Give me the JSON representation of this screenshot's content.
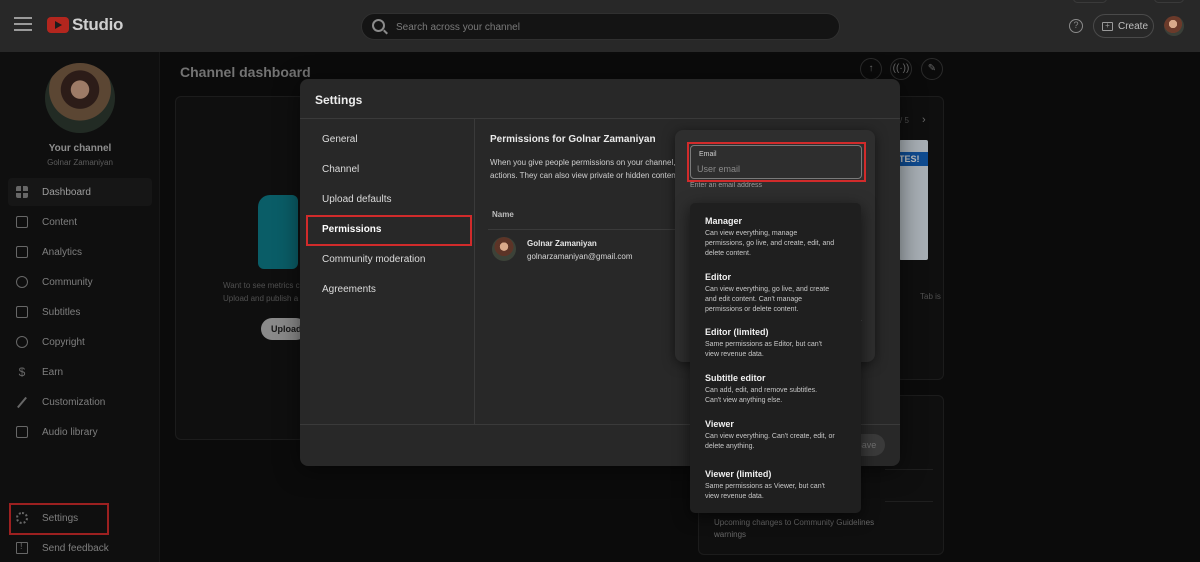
{
  "topbar": {
    "brand": "Studio",
    "search_placeholder": "Search across your channel",
    "help_label": "?",
    "create_label": "Create"
  },
  "sidebar": {
    "channel_title": "Your channel",
    "channel_name": "Golnar Zamaniyan",
    "items": [
      {
        "label": "Dashboard",
        "icon": "dashboard-icon"
      },
      {
        "label": "Content",
        "icon": "content-icon"
      },
      {
        "label": "Analytics",
        "icon": "analytics-icon"
      },
      {
        "label": "Community",
        "icon": "community-icon"
      },
      {
        "label": "Subtitles",
        "icon": "subtitles-icon"
      },
      {
        "label": "Copyright",
        "icon": "copyright-icon"
      },
      {
        "label": "Earn",
        "icon": "dollar-icon"
      },
      {
        "label": "Customization",
        "icon": "wand-icon"
      },
      {
        "label": "Audio library",
        "icon": "audio-library-icon"
      }
    ],
    "settings_label": "Settings",
    "feedback_label": "Send feedback"
  },
  "dashboard": {
    "title": "Channel dashboard",
    "metrics_text_1": "Want to see metrics c",
    "metrics_text_2": "Upload and publish a",
    "upload_label": "Upload",
    "pager": "/ 5",
    "tab_text": "Tab is",
    "banner_text": "TES!",
    "guideline_line1": "Upcoming changes to Community Guidelines",
    "guideline_line2": "warnings"
  },
  "settings": {
    "title": "Settings",
    "menu": [
      "General",
      "Channel",
      "Upload defaults",
      "Permissions",
      "Community moderation",
      "Agreements"
    ],
    "active_menu": "Permissions",
    "permissions": {
      "title": "Permissions for Golnar Zamaniyan",
      "desc_line1": "When you give people permissions on your channel,",
      "desc_line2": "actions. They can also view private or hidden conten",
      "col_name": "Name",
      "user_name": "Golnar Zamaniyan",
      "user_email": "golnarzamaniyan@gmail.com"
    },
    "save_label": "Save"
  },
  "invite": {
    "email_label": "Email",
    "email_placeholder": "User email",
    "email_help": "Enter an email address"
  },
  "roles": [
    {
      "title": "Manager",
      "desc": [
        "Can view everything, manage",
        "permissions, go live, and create, edit, and",
        "delete content."
      ]
    },
    {
      "title": "Editor",
      "desc": [
        "Can view everything, go live, and create",
        "and edit content. Can't manage",
        "permissions or delete content."
      ]
    },
    {
      "title": "Editor (limited)",
      "desc": [
        "Same permissions as Editor, but can't",
        "view revenue data."
      ]
    },
    {
      "title": "Subtitle editor",
      "desc": [
        "Can add, edit, and remove subtitles.",
        "Can't view anything else."
      ]
    },
    {
      "title": "Viewer",
      "desc": [
        "Can view everything. Can't create, edit, or",
        "delete anything."
      ]
    },
    {
      "title": "Viewer (limited)",
      "desc": [
        "Same permissions as Viewer, but can't",
        "view revenue data."
      ]
    }
  ],
  "colors": {
    "highlight": "#d12b2b",
    "brand_red": "#b3261e",
    "modal_bg": "#282828",
    "dropdown_bg": "#1f1f1f"
  }
}
